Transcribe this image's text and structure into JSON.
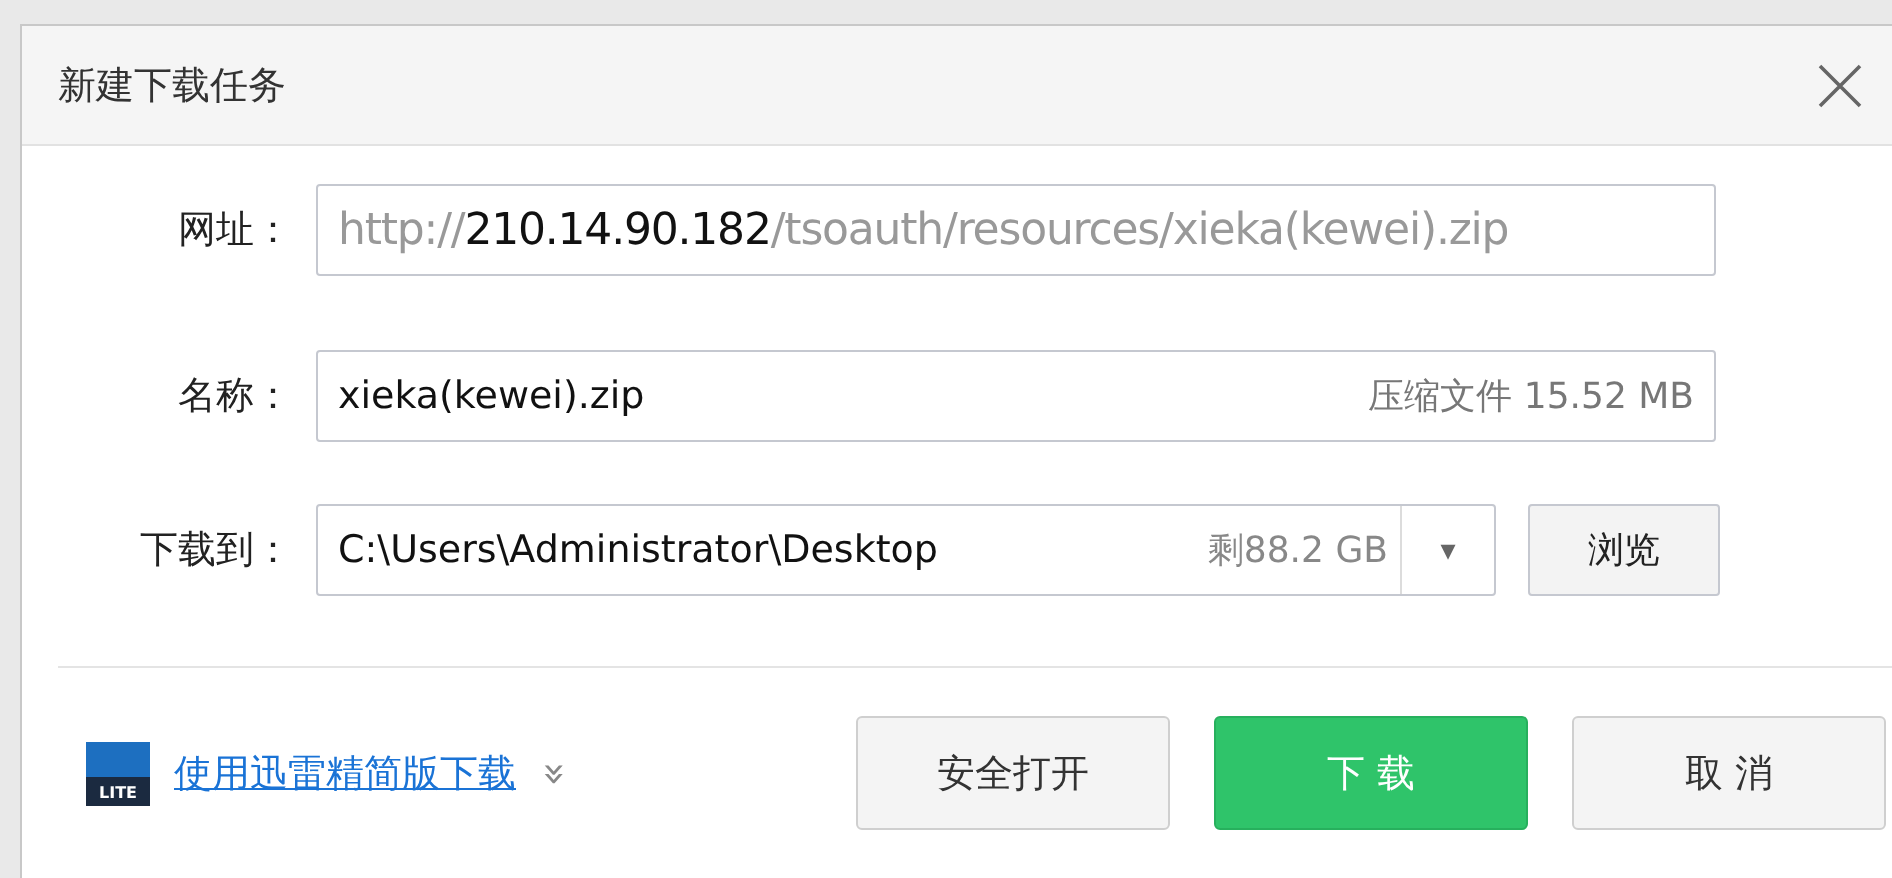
{
  "window": {
    "title": "新建下载任务"
  },
  "url": {
    "label": "网址：",
    "parts": [
      {
        "text": "http://",
        "emphasis": false
      },
      {
        "text": "210.14.90.182",
        "emphasis": true
      },
      {
        "text": "/tsoauth/resources/xieka(kewei).zip",
        "emphasis": false
      }
    ]
  },
  "name": {
    "label": "名称：",
    "value": "xieka(kewei).zip",
    "info": "压缩文件 15.52 MB"
  },
  "save_to": {
    "label": "下载到：",
    "value": "C:\\Users\\Administrator\\Desktop",
    "free_space": "剩88.2 GB",
    "dropdown_glyph": "▾",
    "browse_button": "浏览"
  },
  "footer": {
    "app_icon_label": "LITE",
    "link": "使用迅雷精简版下载",
    "more_glyph": "»",
    "buttons": [
      {
        "label": "安全打开",
        "kind": "normal"
      },
      {
        "label": "下 载",
        "kind": "primary"
      },
      {
        "label": "取 消",
        "kind": "normal"
      }
    ]
  }
}
